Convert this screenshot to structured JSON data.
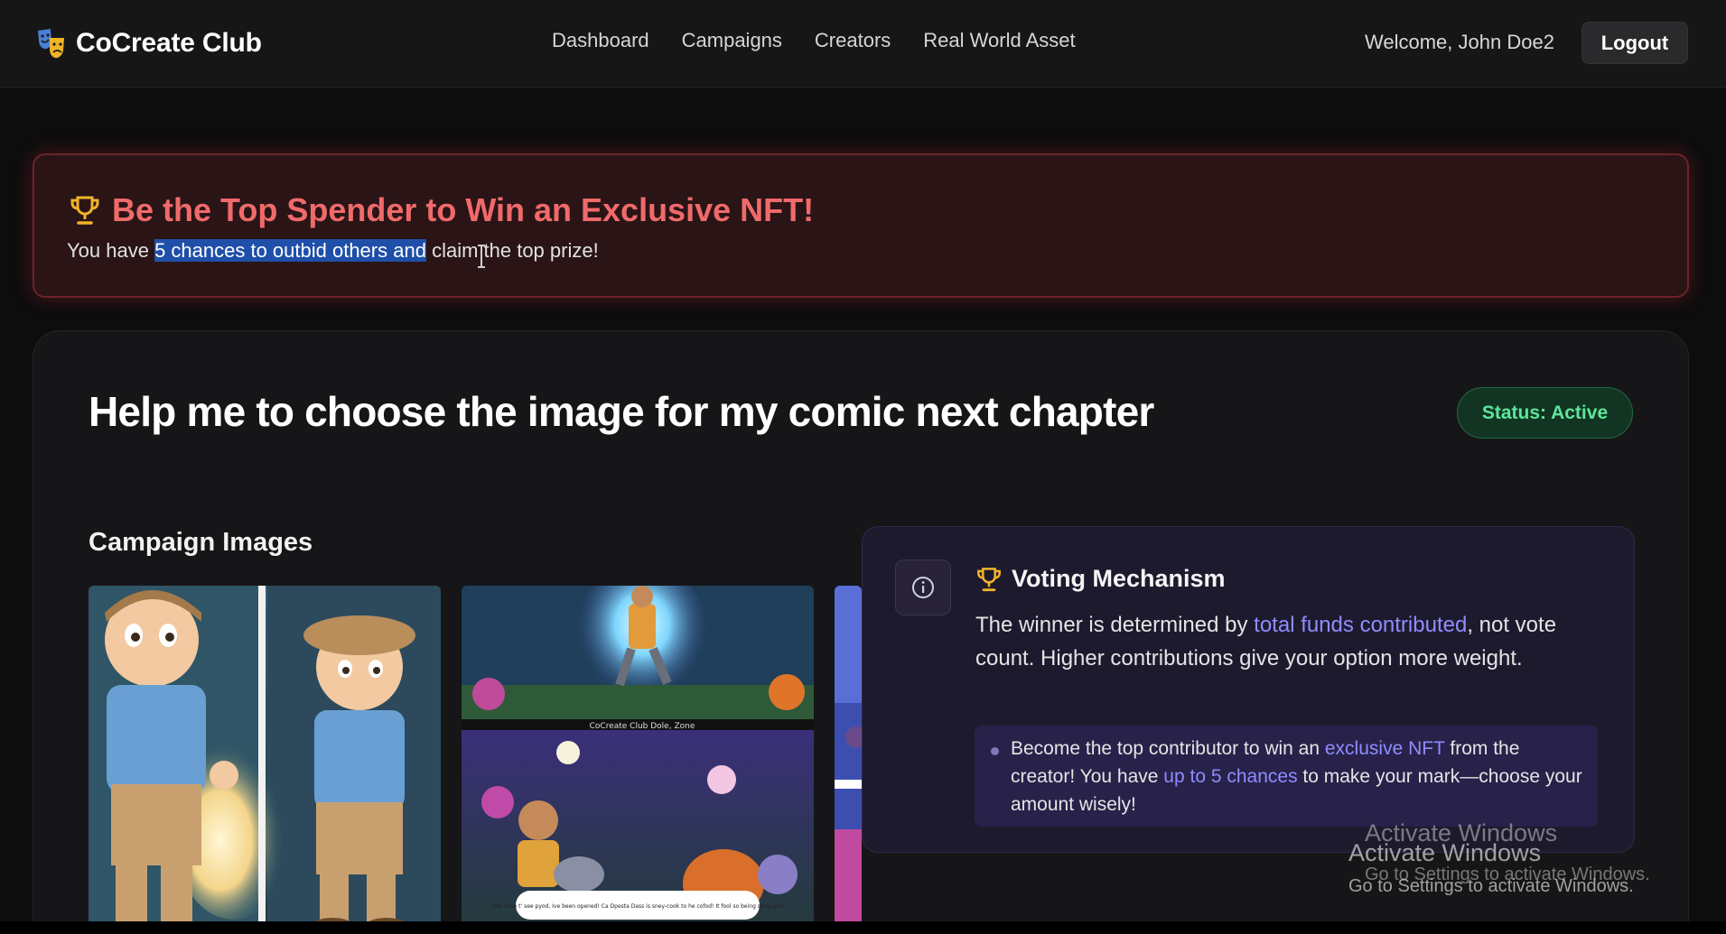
{
  "header": {
    "brand": "CoCreate Club",
    "logo_icon": "theater-masks-icon",
    "nav": [
      "Dashboard",
      "Campaigns",
      "Creators",
      "Real World Asset"
    ],
    "welcome": "Welcome, John Doe2",
    "logout_label": "Logout"
  },
  "banner": {
    "title": "Be the Top Spender to Win an Exclusive NFT!",
    "subtitle_pre": "You have ",
    "subtitle_selected": "5 chances to outbid others and",
    "subtitle_post": " claim the top prize!",
    "icon": "trophy-icon"
  },
  "campaign": {
    "title": "Help me to choose the image for my comic next chapter",
    "status": "Status: Active",
    "images_heading": "Campaign Images",
    "image_captions": {
      "thumb2_caption_top": "CoCreate Club Dole, Zone",
      "thumb2_caption_bottom": "Wat vose t' see pyod, Ive been opened! Ca Dpesta Dass is sney-cook to he cofod! It fool so being sang also"
    }
  },
  "voting": {
    "title": "Voting Mechanism",
    "desc_pre": "The winner is determined by ",
    "desc_hl": "total funds contributed",
    "desc_post": ", not vote count. Higher contributions give your option more weight.",
    "callout_pre": "Become the top contributor to win an ",
    "callout_hl1": "exclusive NFT",
    "callout_mid": " from the creator! You have ",
    "callout_hl2": "up to 5 chances",
    "callout_post": " to make your mark—choose your amount wisely!",
    "info_icon": "info-icon"
  },
  "watermark": {
    "line1": "Activate Windows",
    "line2": "Go to Settings to activate Windows."
  },
  "colors": {
    "accent_red": "#f06a6a",
    "accent_link": "#8f8cff",
    "status_green": "#5ee69a"
  }
}
